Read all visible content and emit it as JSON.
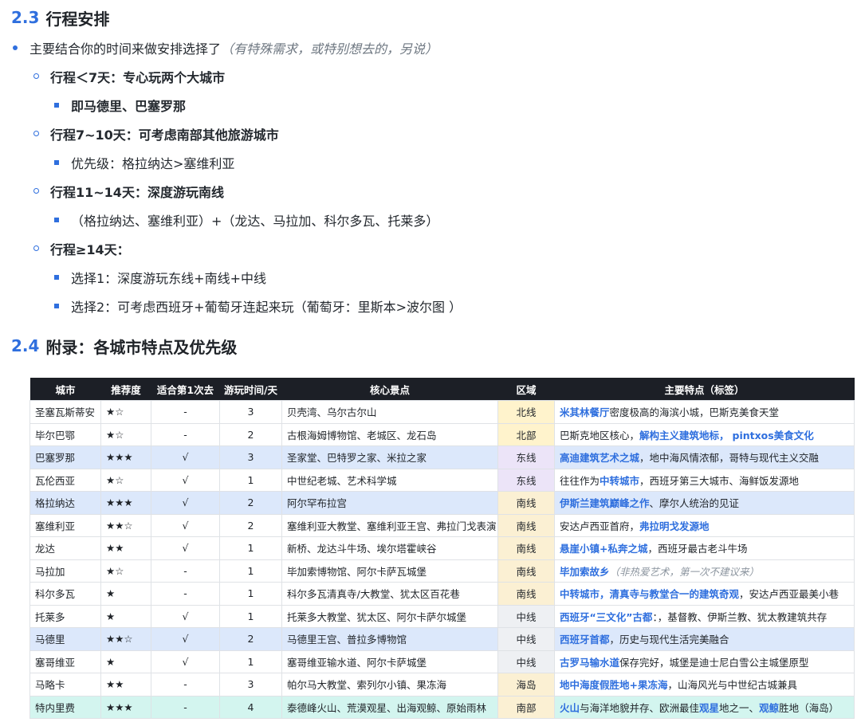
{
  "section_1": {
    "number": "2.3",
    "title": "行程安排"
  },
  "intro": {
    "text": "主要结合你的时间来做安排选择了",
    "note": "（有特殊需求，或特别想去的，另说）"
  },
  "plans": [
    {
      "label": "行程＜7天：专心玩两个大城市",
      "sub": [
        "即马德里、巴塞罗那"
      ]
    },
    {
      "label": "行程7~10天：可考虑南部其他旅游城市",
      "sub": [
        "优先级：格拉纳达>塞维利亚"
      ]
    },
    {
      "label": "行程11~14天：深度游玩南线",
      "sub": [
        "（格拉纳达、塞维利亚）+（龙达、马拉加、科尔多瓦、托莱多）"
      ]
    },
    {
      "label": "行程≥14天：",
      "sub": [
        "选择1：深度游玩东线+南线+中线",
        "选择2：可考虑西班牙+葡萄牙连起来玩（葡萄牙：里斯本>波尔图 ）"
      ]
    }
  ],
  "section_2": {
    "number": "2.4",
    "title": "附录：各城市特点及优先级"
  },
  "table": {
    "headers": [
      "城市",
      "推荐度",
      "适合第1次去",
      "游玩时间/天",
      "核心景点",
      "区域",
      "主要特点（标签）"
    ],
    "rows": [
      {
        "city": "圣塞瓦斯蒂安",
        "stars": "★☆",
        "first": "-",
        "days": "3",
        "sights": "贝壳湾、乌尔古尔山",
        "region": "北线",
        "rc": "north",
        "hl": "",
        "feat": [
          {
            "t": "米其林餐厅",
            "s": "blue"
          },
          {
            "t": "密度极高的海滨小城，巴斯克美食天堂",
            "s": ""
          }
        ]
      },
      {
        "city": "毕尔巴鄂",
        "stars": "★☆",
        "first": "-",
        "days": "2",
        "sights": "古根海姆博物馆、老城区、龙石岛",
        "region": "北部",
        "rc": "north",
        "hl": "",
        "feat": [
          {
            "t": "巴斯克地区核心，",
            "s": ""
          },
          {
            "t": "解构主义建筑地标，",
            "s": "blue"
          },
          {
            "t": "  ",
            "s": ""
          },
          {
            "t": "pintxos美食文化",
            "s": "blue"
          }
        ]
      },
      {
        "city": "巴塞罗那",
        "stars": "★★★",
        "first": "√",
        "days": "3",
        "sights": "圣家堂、巴特罗之家、米拉之家",
        "region": "东线",
        "rc": "east",
        "hl": "blue",
        "feat": [
          {
            "t": "高迪建筑艺术之城",
            "s": "blue"
          },
          {
            "t": "，地中海风情浓郁，哥特与现代主义交融",
            "s": ""
          }
        ]
      },
      {
        "city": "瓦伦西亚",
        "stars": "★☆",
        "first": "√",
        "days": "1",
        "sights": "中世纪老城、艺术科学城",
        "region": "东线",
        "rc": "east",
        "hl": "",
        "feat": [
          {
            "t": "往往作为",
            "s": ""
          },
          {
            "t": "中转城市",
            "s": "blue"
          },
          {
            "t": "，西班牙第三大城市、海鲜饭发源地",
            "s": ""
          }
        ]
      },
      {
        "city": "格拉纳达",
        "stars": "★★★",
        "first": "√",
        "days": "2",
        "sights": "阿尔罕布拉宫",
        "region": "南线",
        "rc": "south",
        "hl": "blue",
        "feat": [
          {
            "t": "伊斯兰建筑巅峰之作",
            "s": "blue"
          },
          {
            "t": "、摩尔人统治的见证",
            "s": ""
          }
        ]
      },
      {
        "city": "塞维利亚",
        "stars": "★★☆",
        "first": "√",
        "days": "2",
        "sights": "塞维利亚大教堂、塞维利亚王宫、弗拉门戈表演",
        "region": "南线",
        "rc": "south",
        "hl": "",
        "feat": [
          {
            "t": "安达卢西亚首府，",
            "s": ""
          },
          {
            "t": "弗拉明戈发源地",
            "s": "blue"
          }
        ]
      },
      {
        "city": "龙达",
        "stars": "★★",
        "first": "√",
        "days": "1",
        "sights": "新桥、龙达斗牛场、埃尔塔霍峡谷",
        "region": "南线",
        "rc": "south",
        "hl": "",
        "feat": [
          {
            "t": "悬崖小镇+私奔之城",
            "s": "blue"
          },
          {
            "t": "，西班牙最古老斗牛场",
            "s": ""
          }
        ]
      },
      {
        "city": "马拉加",
        "stars": "★☆",
        "first": "-",
        "days": "1",
        "sights": "毕加索博物馆、阿尔卡萨瓦城堡",
        "region": "南线",
        "rc": "south",
        "hl": "",
        "feat": [
          {
            "t": "毕加索故乡",
            "s": "blue"
          },
          {
            "t": "（非热爱艺术，第一次不建议来）",
            "s": "gray"
          }
        ]
      },
      {
        "city": "科尔多瓦",
        "stars": "★",
        "first": "-",
        "days": "1",
        "sights": "科尔多瓦清真寺/大教堂、犹太区百花巷",
        "region": "南线",
        "rc": "south",
        "hl": "",
        "feat": [
          {
            "t": "中转城市，清真寺与教堂合一的建筑奇观",
            "s": "blue"
          },
          {
            "t": "，安达卢西亚最美小巷",
            "s": ""
          }
        ]
      },
      {
        "city": "托莱多",
        "stars": "★",
        "first": "√",
        "days": "1",
        "sights": "托莱多大教堂、犹太区、阿尔卡萨尔城堡",
        "region": "中线",
        "rc": "mid",
        "hl": "",
        "feat": [
          {
            "t": "西班牙“三文化”古都",
            "s": "blue"
          },
          {
            "t": "：，基督教、伊斯兰教、犹太教建筑共存",
            "s": ""
          }
        ]
      },
      {
        "city": "马德里",
        "stars": "★★☆",
        "first": "√",
        "days": "2",
        "sights": "马德里王宫、普拉多博物馆",
        "region": "中线",
        "rc": "mid",
        "hl": "blue",
        "feat": [
          {
            "t": "西班牙首都",
            "s": "blue"
          },
          {
            "t": "，历史与现代生活完美融合",
            "s": ""
          }
        ]
      },
      {
        "city": "塞哥维亚",
        "stars": "★",
        "first": "√",
        "days": "1",
        "sights": "塞哥维亚输水道、阿尔卡萨城堡",
        "region": "中线",
        "rc": "mid",
        "hl": "",
        "feat": [
          {
            "t": "古罗马输水道",
            "s": "blue"
          },
          {
            "t": "保存完好，城堡是迪士尼白雪公主城堡原型",
            "s": ""
          }
        ]
      },
      {
        "city": "马略卡",
        "stars": "★★",
        "first": "-",
        "days": "3",
        "sights": "帕尔马大教堂、索列尔小镇、果冻海",
        "region": "海岛",
        "rc": "island",
        "hl": "",
        "feat": [
          {
            "t": "地中海度假胜地+果冻海",
            "s": "blue"
          },
          {
            "t": "，山海风光与中世纪古城兼具",
            "s": ""
          }
        ]
      },
      {
        "city": "特内里费",
        "stars": "★★★",
        "first": "-",
        "days": "4",
        "sights": "泰德峰火山、荒漠观星、出海观鲸、原始雨林",
        "region": "南部",
        "rc": "island",
        "hl": "teal",
        "feat": [
          {
            "t": "火山",
            "s": "blue"
          },
          {
            "t": "与海洋地貌并存、欧洲最佳",
            "s": ""
          },
          {
            "t": "观星",
            "s": "blue"
          },
          {
            "t": "地之一、",
            "s": ""
          },
          {
            "t": "观鲸",
            "s": "blue"
          },
          {
            "t": "胜地（海岛）",
            "s": ""
          }
        ]
      }
    ]
  }
}
